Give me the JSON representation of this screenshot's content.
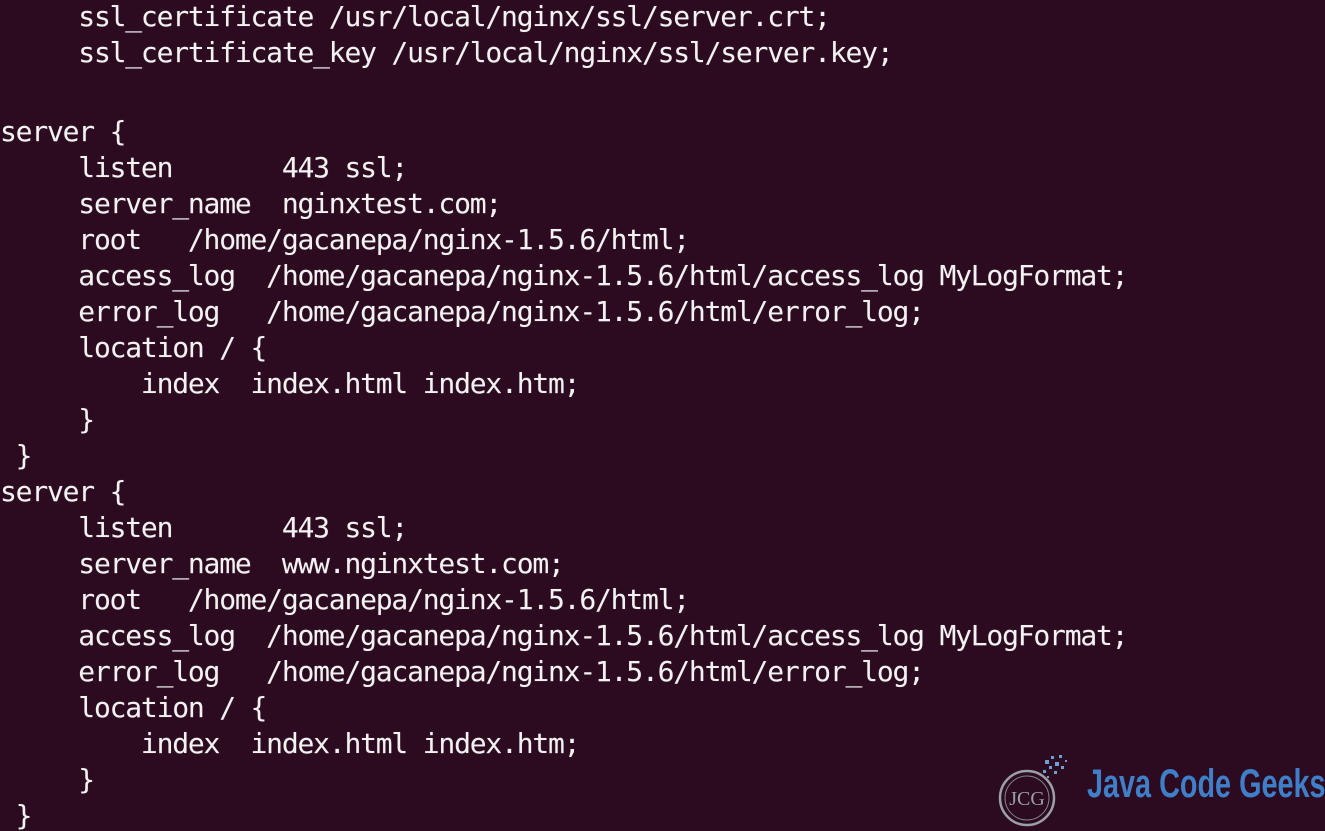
{
  "terminal": {
    "lines": [
      "     ssl_certificate /usr/local/nginx/ssl/server.crt;",
      "     ssl_certificate_key /usr/local/nginx/ssl/server.key;",
      "",
      "server {",
      "     listen       443 ssl;",
      "     server_name  nginxtest.com;",
      "     root   /home/gacanepa/nginx-1.5.6/html;",
      "     access_log  /home/gacanepa/nginx-1.5.6/html/access_log MyLogFormat;",
      "     error_log   /home/gacanepa/nginx-1.5.6/html/error_log;",
      "     location / {",
      "         index  index.html index.htm;",
      "     }",
      " }",
      "server {",
      "     listen       443 ssl;",
      "     server_name  www.nginxtest.com;",
      "     root   /home/gacanepa/nginx-1.5.6/html;",
      "     access_log  /home/gacanepa/nginx-1.5.6/html/access_log MyLogFormat;",
      "     error_log   /home/gacanepa/nginx-1.5.6/html/error_log;",
      "     location / {",
      "         index  index.html index.htm;",
      "     }",
      " }"
    ],
    "background_color": "#2c0a1f",
    "text_color": "#f2f2f2"
  },
  "watermark": {
    "emblem_text": "JCG",
    "brand_text": "Java Code Geeks",
    "brand_color": "#3f7fc8"
  }
}
